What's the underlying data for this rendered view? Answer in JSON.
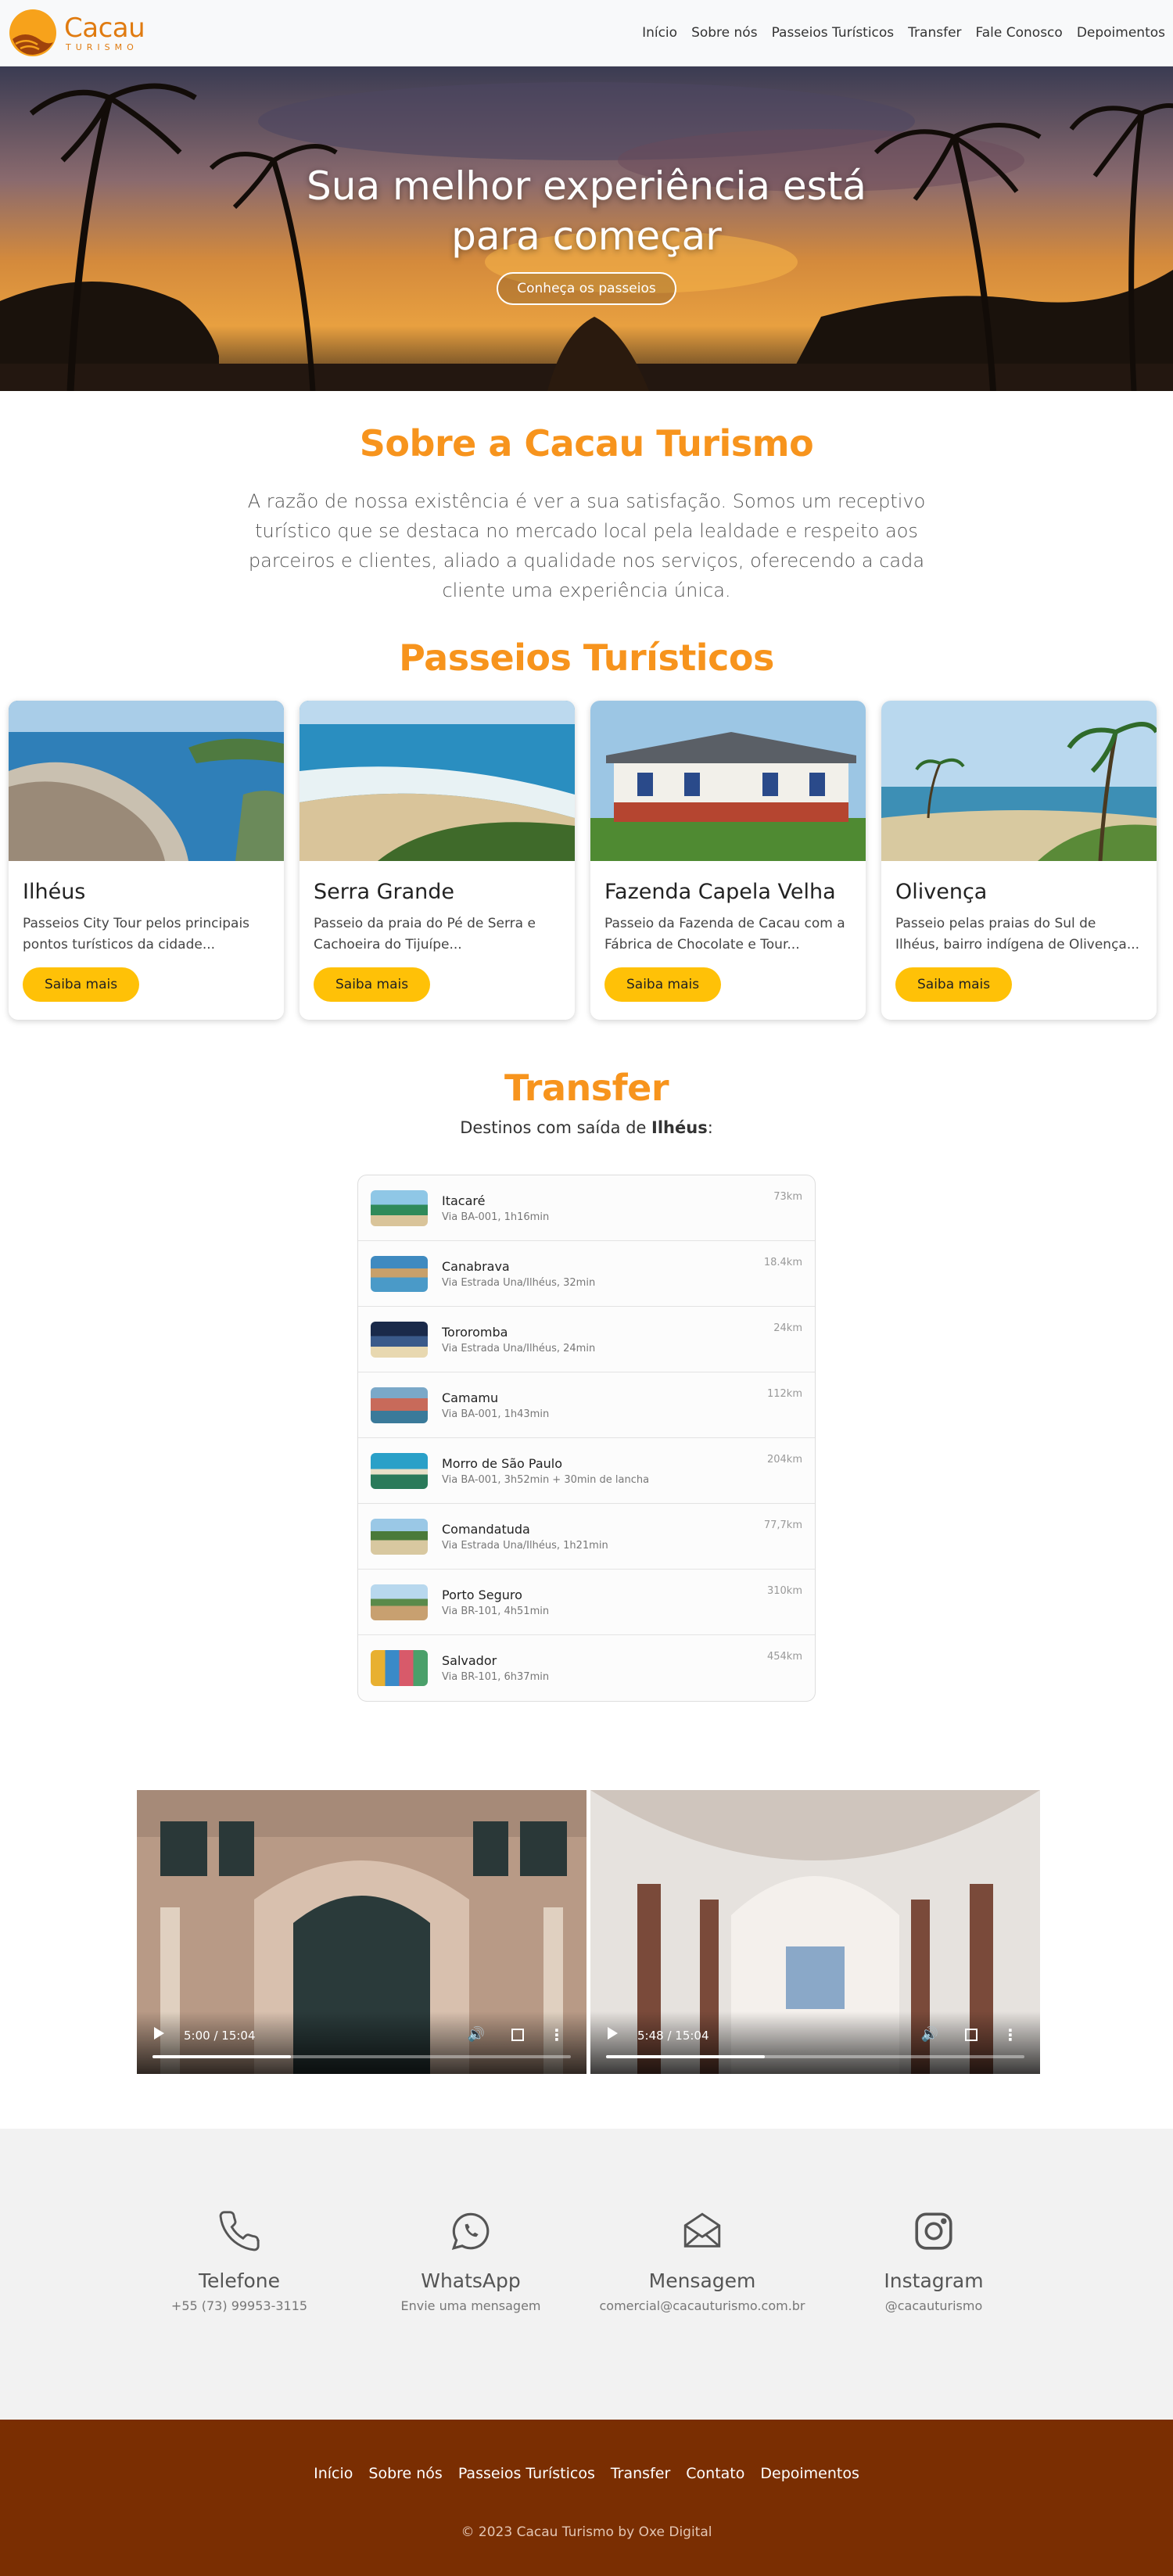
{
  "brand": {
    "name": "Cacau",
    "sub": "TURISMO"
  },
  "nav": [
    "Início",
    "Sobre nós",
    "Passeios Turísticos",
    "Transfer",
    "Fale Conosco",
    "Depoimentos"
  ],
  "hero": {
    "title": "Sua melhor experiência está para começar",
    "button": "Conheça os passeios"
  },
  "about": {
    "title": "Sobre a Cacau Turismo",
    "text": "A razão de nossa existência é ver a sua satisfação. Somos um receptivo turístico que se destaca no mercado local pela lealdade e respeito aos parceiros e clientes, aliado a qualidade nos serviços, oferecendo a cada cliente uma experiência única."
  },
  "passeios": {
    "title": "Passeios Turísticos",
    "cards": [
      {
        "title": "Ilhéus",
        "desc": "Passeios City Tour pelos principais pontos turísticos da cidade...",
        "button": "Saiba mais"
      },
      {
        "title": "Serra Grande",
        "desc": "Passeio da praia do Pé de Serra e Cachoeira do Tijuípe...",
        "button": "Saiba mais"
      },
      {
        "title": "Fazenda Capela Velha",
        "desc": "Passeio da Fazenda de Cacau com a Fábrica de Chocolate e Tour...",
        "button": "Saiba mais"
      },
      {
        "title": "Olivença",
        "desc": "Passeio pelas praias do Sul de Ilhéus, bairro indígena de Olivença...",
        "button": "Saiba mais"
      }
    ]
  },
  "transfer": {
    "title": "Transfer",
    "sub_prefix": "Destinos com saída de ",
    "sub_city": "Ilhéus",
    "sub_suffix": ":",
    "items": [
      {
        "name": "Itacaré",
        "route": "Via BA-001, 1h16min",
        "dist": "73km"
      },
      {
        "name": "Canabrava",
        "route": "Via Estrada Una/Ilhéus, 32min",
        "dist": "18.4km"
      },
      {
        "name": "Tororomba",
        "route": "Via Estrada Una/Ilhéus, 24min",
        "dist": "24km"
      },
      {
        "name": "Camamu",
        "route": "Via BA-001, 1h43min",
        "dist": "112km"
      },
      {
        "name": "Morro de São Paulo",
        "route": "Via BA-001, 3h52min + 30min de lancha",
        "dist": "204km"
      },
      {
        "name": "Comandatuda",
        "route": "Via Estrada Una/Ilhéus, 1h21min",
        "dist": "77,7km"
      },
      {
        "name": "Porto Seguro",
        "route": "Via BR-101, 4h51min",
        "dist": "310km"
      },
      {
        "name": "Salvador",
        "route": "Via BR-101, 6h37min",
        "dist": "454km"
      }
    ]
  },
  "videos": [
    {
      "time": "5:00 / 15:04",
      "progress": 0.33
    },
    {
      "time": "5:48 / 15:04",
      "progress": 0.38
    }
  ],
  "contact": [
    {
      "icon": "phone-icon",
      "title": "Telefone",
      "sub": "+55 (73) 99953-3115"
    },
    {
      "icon": "whatsapp-icon",
      "title": "WhatsApp",
      "sub": "Envie uma mensagem"
    },
    {
      "icon": "envelope-icon",
      "title": "Mensagem",
      "sub": "comercial@cacauturismo.com.br"
    },
    {
      "icon": "instagram-icon",
      "title": "Instagram",
      "sub": "@cacauturismo"
    }
  ],
  "footer": {
    "links": [
      "Início",
      "Sobre nós",
      "Passeios Turísticos",
      "Transfer",
      "Contato",
      "Depoimentos"
    ],
    "copy": "© 2023 Cacau Turismo by Oxe Digital"
  },
  "colors": {
    "accent": "#f7941d",
    "button": "#ffc107",
    "footer": "#7a2e02"
  }
}
